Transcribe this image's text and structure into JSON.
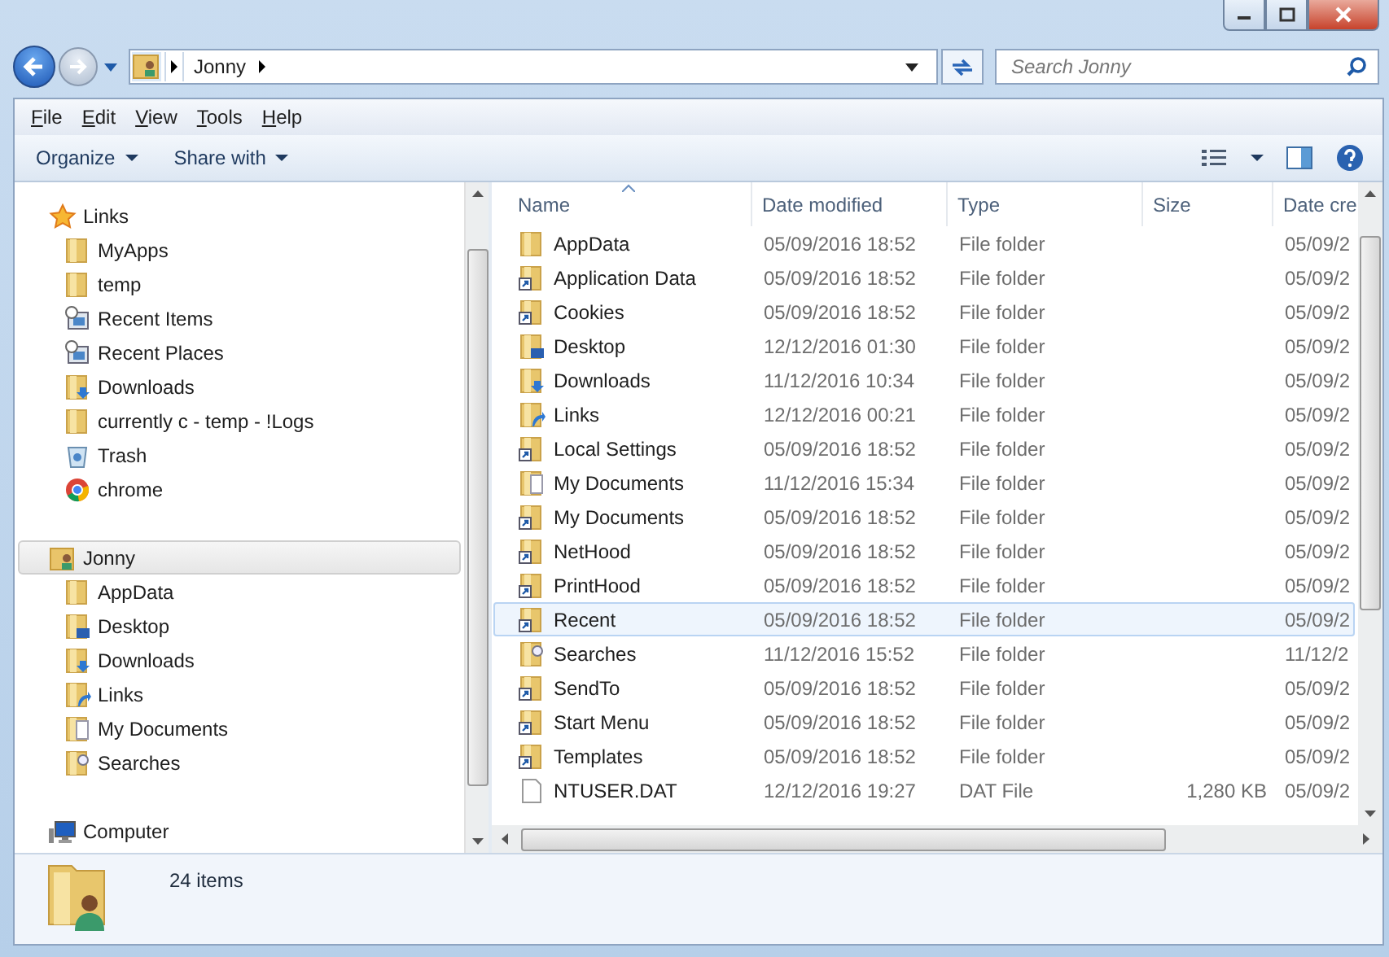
{
  "address": {
    "crumbs": [
      "Jonny"
    ]
  },
  "search": {
    "placeholder": "Search Jonny"
  },
  "menu": [
    "File",
    "Edit",
    "View",
    "Tools",
    "Help"
  ],
  "toolbar": [
    "Organize",
    "Share with"
  ],
  "sidebar": [
    {
      "label": "Links",
      "kind": "star",
      "selected": false,
      "children": [
        {
          "label": "MyApps",
          "kind": "folder"
        },
        {
          "label": "temp",
          "kind": "folder"
        },
        {
          "label": "Recent Items",
          "kind": "recent"
        },
        {
          "label": "Recent Places",
          "kind": "recent"
        },
        {
          "label": "Downloads",
          "kind": "downloads"
        },
        {
          "label": "currently c - temp - !Logs",
          "kind": "folder"
        },
        {
          "label": "Trash",
          "kind": "trash"
        },
        {
          "label": "chrome",
          "kind": "chrome"
        }
      ]
    },
    {
      "label": "Jonny",
      "kind": "user",
      "selected": true,
      "children": [
        {
          "label": "AppData",
          "kind": "folder"
        },
        {
          "label": "Desktop",
          "kind": "desktop"
        },
        {
          "label": "Downloads",
          "kind": "downloads"
        },
        {
          "label": "Links",
          "kind": "links"
        },
        {
          "label": "My Documents",
          "kind": "documents"
        },
        {
          "label": "Searches",
          "kind": "searches"
        }
      ]
    },
    {
      "label": "Computer",
      "kind": "computer",
      "selected": false
    }
  ],
  "table": {
    "columns": [
      {
        "label": "Name",
        "sorted": true
      },
      {
        "label": "Date modified",
        "sorted": false
      },
      {
        "label": "Type",
        "sorted": false
      },
      {
        "label": "Size",
        "sorted": false
      },
      {
        "label": "Date cre",
        "sorted": false
      }
    ],
    "rows": [
      {
        "name": "AppData",
        "date": "05/09/2016 18:52",
        "type": "File folder",
        "size": "",
        "created": "05/09/2",
        "kind": "folder",
        "selected": false
      },
      {
        "name": "Application Data",
        "date": "05/09/2016 18:52",
        "type": "File folder",
        "size": "",
        "created": "05/09/2",
        "kind": "shortcut",
        "selected": false
      },
      {
        "name": "Cookies",
        "date": "05/09/2016 18:52",
        "type": "File folder",
        "size": "",
        "created": "05/09/2",
        "kind": "shortcut",
        "selected": false
      },
      {
        "name": "Desktop",
        "date": "12/12/2016 01:30",
        "type": "File folder",
        "size": "",
        "created": "05/09/2",
        "kind": "desktop",
        "selected": false
      },
      {
        "name": "Downloads",
        "date": "11/12/2016 10:34",
        "type": "File folder",
        "size": "",
        "created": "05/09/2",
        "kind": "downloads",
        "selected": false
      },
      {
        "name": "Links",
        "date": "12/12/2016 00:21",
        "type": "File folder",
        "size": "",
        "created": "05/09/2",
        "kind": "links",
        "selected": false
      },
      {
        "name": "Local Settings",
        "date": "05/09/2016 18:52",
        "type": "File folder",
        "size": "",
        "created": "05/09/2",
        "kind": "shortcut",
        "selected": false
      },
      {
        "name": "My Documents",
        "date": "11/12/2016 15:34",
        "type": "File folder",
        "size": "",
        "created": "05/09/2",
        "kind": "documents",
        "selected": false
      },
      {
        "name": "My Documents",
        "date": "05/09/2016 18:52",
        "type": "File folder",
        "size": "",
        "created": "05/09/2",
        "kind": "shortcut",
        "selected": false
      },
      {
        "name": "NetHood",
        "date": "05/09/2016 18:52",
        "type": "File folder",
        "size": "",
        "created": "05/09/2",
        "kind": "shortcut",
        "selected": false
      },
      {
        "name": "PrintHood",
        "date": "05/09/2016 18:52",
        "type": "File folder",
        "size": "",
        "created": "05/09/2",
        "kind": "shortcut",
        "selected": false
      },
      {
        "name": "Recent",
        "date": "05/09/2016 18:52",
        "type": "File folder",
        "size": "",
        "created": "05/09/2",
        "kind": "shortcut",
        "selected": true
      },
      {
        "name": "Searches",
        "date": "11/12/2016 15:52",
        "type": "File folder",
        "size": "",
        "created": "11/12/2",
        "kind": "searches",
        "selected": false
      },
      {
        "name": "SendTo",
        "date": "05/09/2016 18:52",
        "type": "File folder",
        "size": "",
        "created": "05/09/2",
        "kind": "shortcut",
        "selected": false
      },
      {
        "name": "Start Menu",
        "date": "05/09/2016 18:52",
        "type": "File folder",
        "size": "",
        "created": "05/09/2",
        "kind": "shortcut",
        "selected": false
      },
      {
        "name": "Templates",
        "date": "05/09/2016 18:52",
        "type": "File folder",
        "size": "",
        "created": "05/09/2",
        "kind": "shortcut",
        "selected": false
      },
      {
        "name": "NTUSER.DAT",
        "date": "12/12/2016 19:27",
        "type": "DAT File",
        "size": "1,280 KB",
        "created": "05/09/2",
        "kind": "file",
        "selected": false
      }
    ]
  },
  "status": {
    "count": "24 items"
  }
}
